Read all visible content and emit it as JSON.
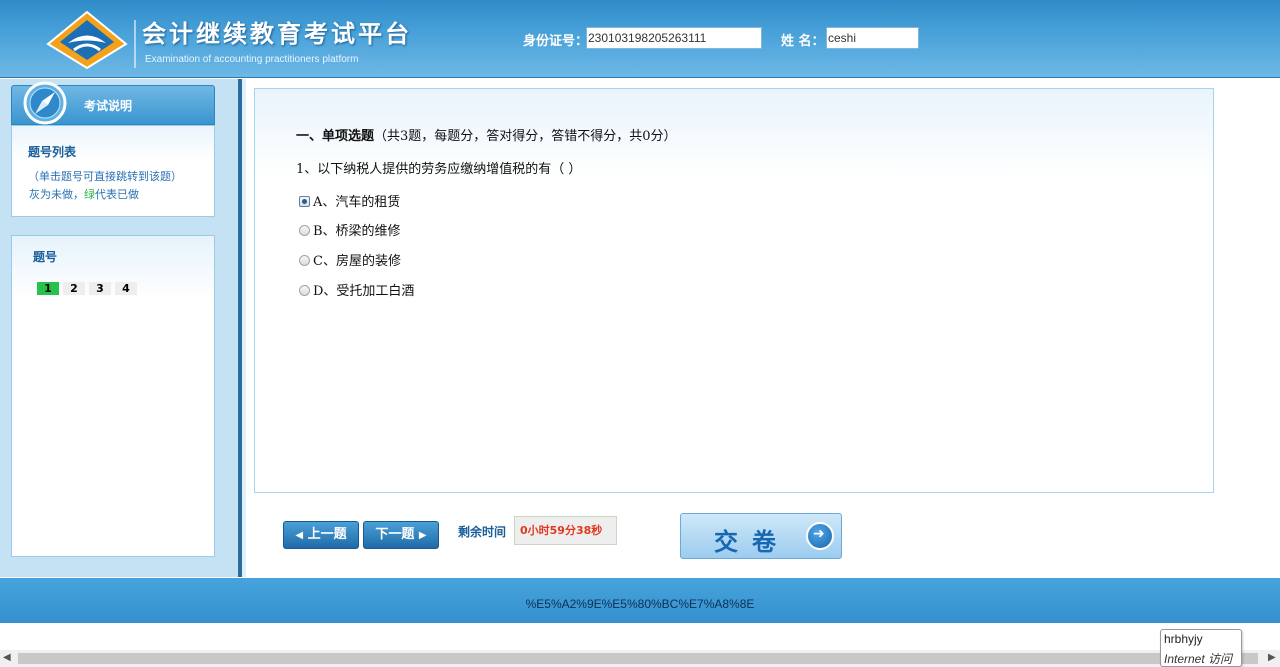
{
  "header": {
    "title": "会计继续教育考试平台",
    "subtitle": "Examination of accounting practitioners platform",
    "id_label": "身份证号：",
    "id_value": "230103198205263111",
    "name_label": "姓 名：",
    "name_value": "ceshi"
  },
  "sidebar": {
    "exam_info_label": "考试说明",
    "question_list_title": "题号列表",
    "question_list_hint1": "（单击题号可直接跳转到该题）",
    "question_list_hint2_gray": "灰为未做，",
    "question_list_hint2_green": "绿",
    "question_list_hint2_rest": "代表已做",
    "numbers_title": "题号",
    "question_numbers": [
      "1",
      "2",
      "3",
      "4"
    ],
    "done_color": "#27c24c",
    "undone_color": "#eeeeee"
  },
  "question": {
    "section_title": "一、单项选题",
    "section_desc": "（共3题，每题分，答对得分，答错不得分，共0分）",
    "text": "1、以下纳税人提供的劳务应缴纳增值税的有（ ）",
    "options": [
      {
        "label": "A、汽车的租赁",
        "selected": true
      },
      {
        "label": "B、桥梁的维修",
        "selected": false
      },
      {
        "label": "C、房屋的装修",
        "selected": false
      },
      {
        "label": "D、受托加工白酒",
        "selected": false
      }
    ]
  },
  "controls": {
    "prev_label": "上一题",
    "next_label": "下一题",
    "timer_label": "剩余时间",
    "timer_value": "0小时59分38秒",
    "submit_label": "交卷"
  },
  "footer": {
    "text": "%E5%A2%9E%E5%80%BC%E7%A8%8E"
  },
  "status": {
    "zone_user": "hrbhyjy",
    "zone_type": "Internet 访问"
  },
  "colors": {
    "header_blue": "#3a95cf",
    "accent_dark": "#1a5f99",
    "timer_red": "#e03a1e"
  }
}
